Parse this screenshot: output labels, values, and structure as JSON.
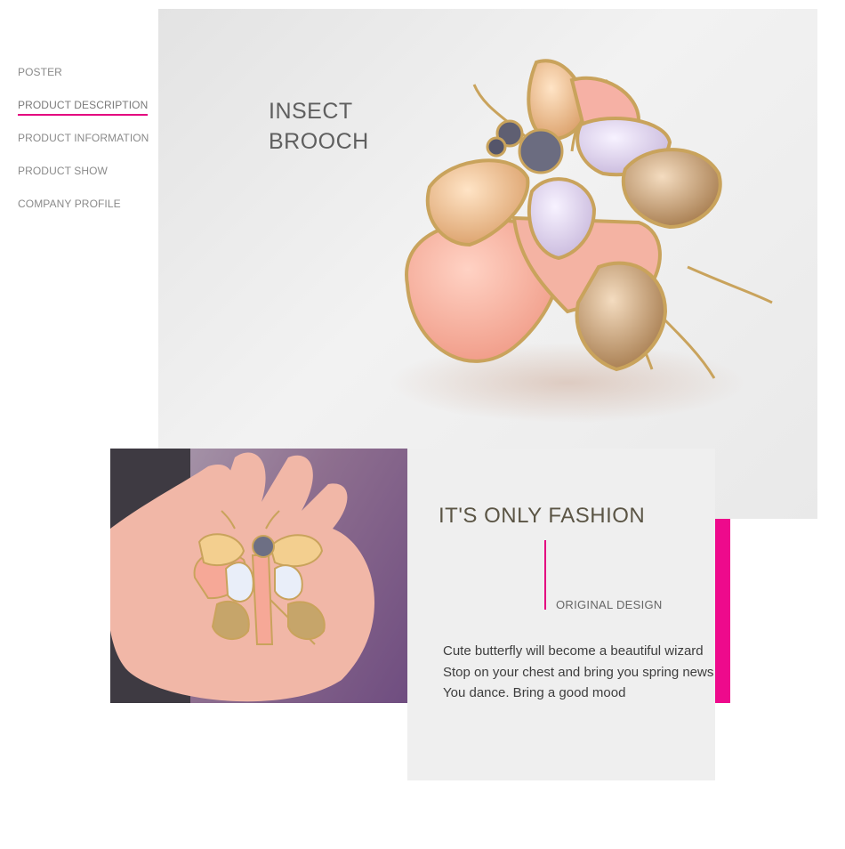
{
  "nav": {
    "items": [
      {
        "label": "POSTER"
      },
      {
        "label": "PRODUCT DESCRIPTION"
      },
      {
        "label": "PRODUCT INFORMATION"
      },
      {
        "label": "PRODUCT SHOW"
      },
      {
        "label": "COMPANY PROFILE"
      }
    ],
    "active_index": 1
  },
  "hero": {
    "title": "INSECT\nBROOCH"
  },
  "feature": {
    "heading": "IT'S ONLY FASHION",
    "subheading": "ORIGINAL DESIGN",
    "description": "Cute butterfly will become a beautiful wizard Stop on your chest and bring you spring news You dance. Bring a good mood"
  },
  "colors": {
    "accent": "#e4007f",
    "accent_bar": "#ee0a8c",
    "card_bg": "#efefef",
    "hero_bg": "#e9e9e9"
  }
}
